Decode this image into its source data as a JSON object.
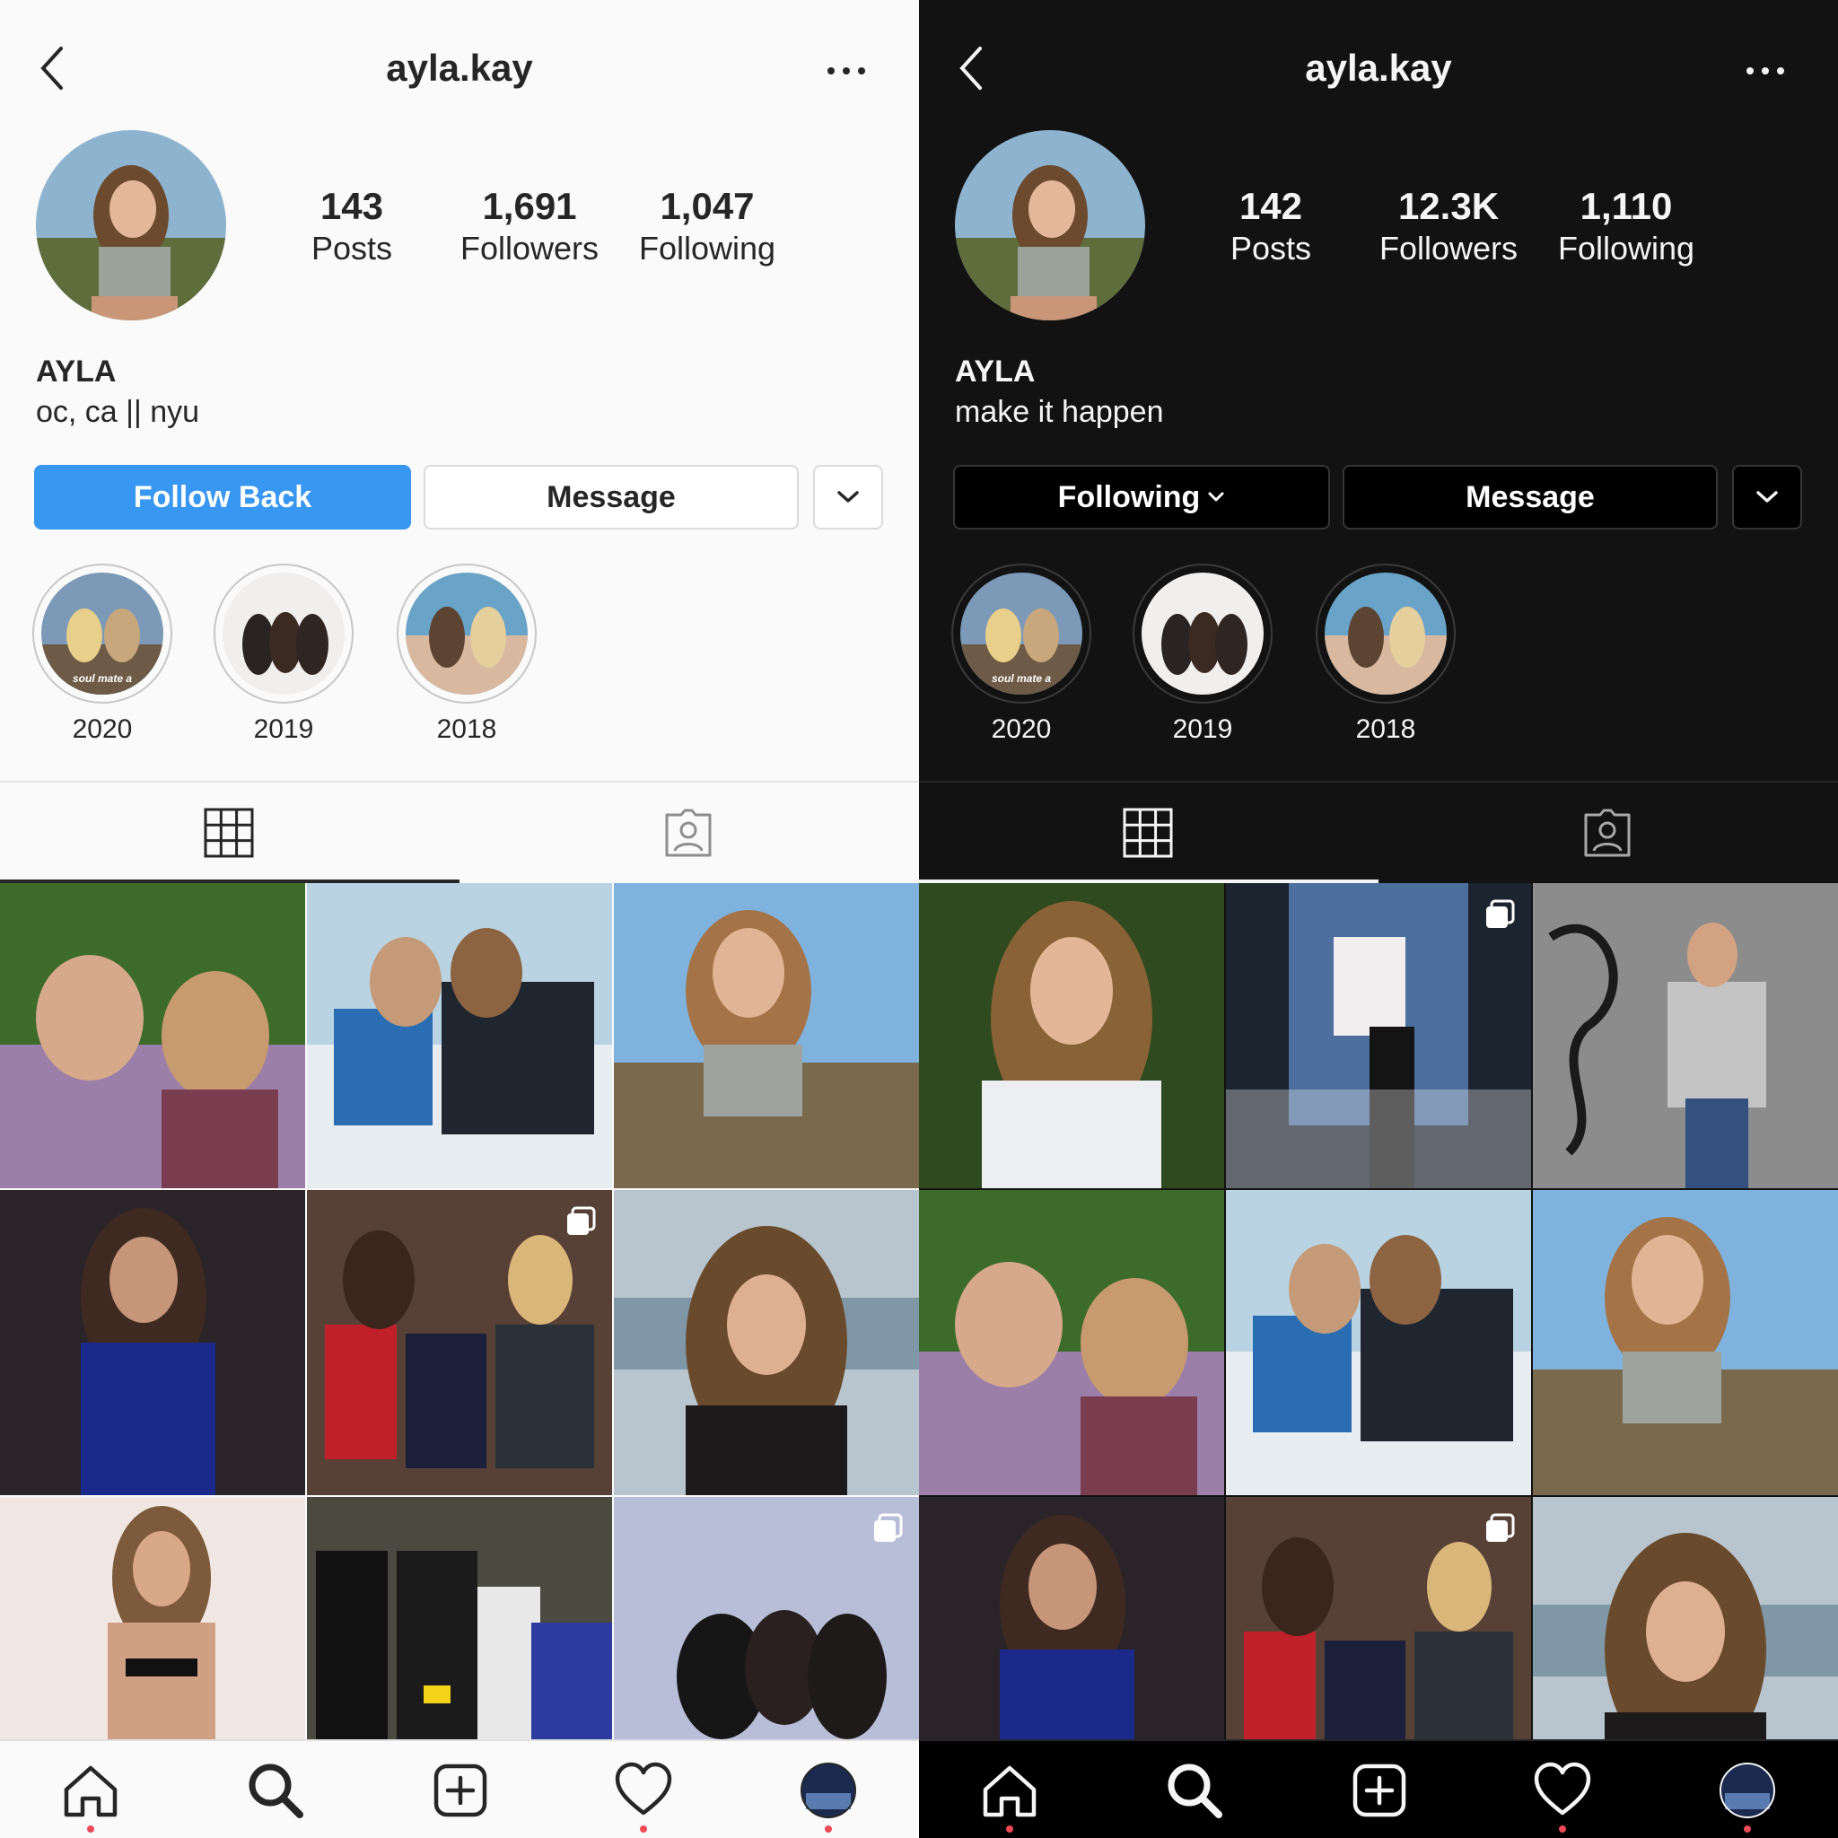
{
  "screens": {
    "light": {
      "username": "ayla.kay",
      "posts_count": "143",
      "posts_label": "Posts",
      "followers_count": "1,691",
      "followers_label": "Followers",
      "following_count": "1,047",
      "following_label": "Following",
      "display_name": "AYLA",
      "bio": "oc, ca || nyu",
      "primary_button": "Follow Back",
      "message_button": "Message",
      "highlights": [
        "2020",
        "2019",
        "2018"
      ]
    },
    "dark": {
      "username": "ayla.kay",
      "posts_count": "142",
      "posts_label": "Posts",
      "followers_count": "12.3K",
      "followers_label": "Followers",
      "following_count": "1,110",
      "following_label": "Following",
      "display_name": "AYLA",
      "bio": "make it happen",
      "primary_button": "Following",
      "message_button": "Message",
      "highlights": [
        "2020",
        "2019",
        "2018"
      ]
    }
  },
  "highlight_caption": "soul mate a",
  "colors": {
    "follow_blue": "#3897f0",
    "notification_red": "#ed4956"
  },
  "icons": {
    "back": "chevron-left-icon",
    "more": "more-horizontal-icon",
    "dropdown": "chevron-down-icon",
    "grid_tab": "grid-icon",
    "tagged_tab": "tagged-person-icon",
    "home": "home-icon",
    "search": "search-icon",
    "new_post": "plus-square-icon",
    "activity": "heart-icon",
    "profile": "profile-avatar"
  }
}
